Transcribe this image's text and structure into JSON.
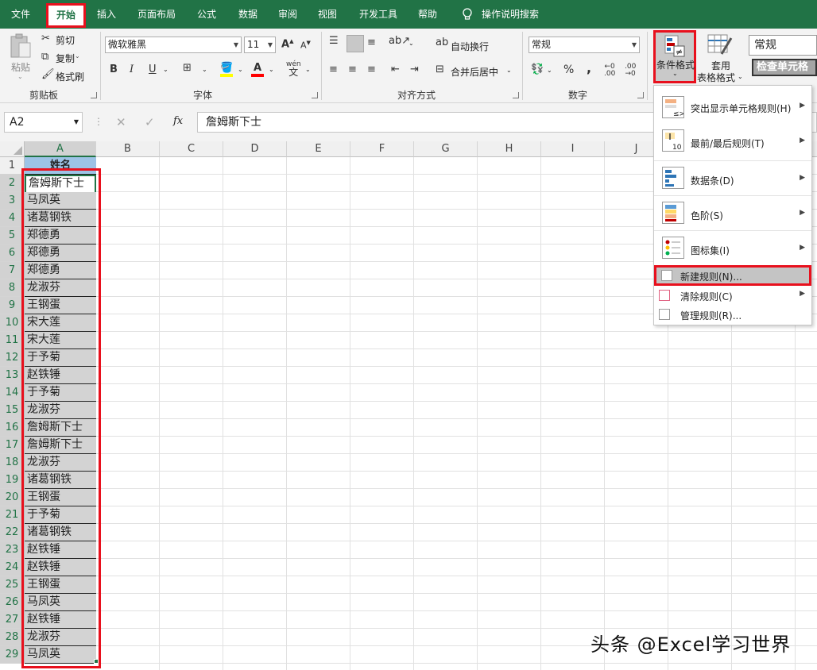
{
  "tabs": [
    "文件",
    "开始",
    "插入",
    "页面布局",
    "公式",
    "数据",
    "审阅",
    "视图",
    "开发工具",
    "帮助",
    "操作说明搜索"
  ],
  "clipboard": {
    "paste": "粘贴",
    "cut": "剪切",
    "copy": "复制",
    "format_painter": "格式刷",
    "label": "剪贴板"
  },
  "font": {
    "name": "微软雅黑",
    "size": "11",
    "bold": "B",
    "italic": "I",
    "underline": "U",
    "label": "字体",
    "bigger": "A",
    "smaller": "A",
    "pinyin": "wén"
  },
  "alignment": {
    "wrap": "自动换行",
    "merge": "合并后居中",
    "label": "对齐方式"
  },
  "number": {
    "format": "常规",
    "percent": "%",
    "comma": ",",
    "label": "数字"
  },
  "styles": {
    "conditional": "条件格式",
    "table_line1": "套用",
    "table_line2": "表格格式",
    "style_normal": "常规",
    "style_check": "检查单元格"
  },
  "name_box": "A2",
  "formula_bar": {
    "fx": "fx",
    "value": "詹姆斯下士"
  },
  "columns": [
    "A",
    "B",
    "C",
    "D",
    "E",
    "F",
    "G",
    "H",
    "I",
    "J"
  ],
  "rows": [
    "1",
    "2",
    "3",
    "4",
    "5",
    "6",
    "7",
    "8",
    "9",
    "10",
    "11",
    "12",
    "13",
    "14",
    "15",
    "16",
    "17",
    "18",
    "19",
    "20",
    "21",
    "22",
    "23",
    "24",
    "25",
    "26",
    "27",
    "28",
    "29"
  ],
  "header_cell": "姓名",
  "cells": [
    "詹姆斯下士",
    "马凤英",
    "诸葛钢铁",
    "郑德勇",
    "郑德勇",
    "郑德勇",
    "龙淑芬",
    "王钢蛋",
    "宋大莲",
    "宋大莲",
    "于予菊",
    "赵铁锤",
    "于予菊",
    "龙淑芬",
    "詹姆斯下士",
    "詹姆斯下士",
    "龙淑芬",
    "诸葛钢铁",
    "王钢蛋",
    "于予菊",
    "诸葛钢铁",
    "赵铁锤",
    "赵铁锤",
    "王钢蛋",
    "马凤英",
    "赵铁锤",
    "龙淑芬",
    "马凤英"
  ],
  "menu": {
    "highlight": "突出显示单元格规则(H)",
    "topbottom": "最前/最后规则(T)",
    "databar": "数据条(D)",
    "colorscale": "色阶(S)",
    "iconset": "图标集(I)",
    "new_rule": "新建规则(N)...",
    "clear_rule": "清除规则(C)",
    "manage_rule": "管理规则(R)..."
  },
  "watermark": "头条 @Excel学习世界",
  "colors": {
    "excel_green": "#217346",
    "highlight_red": "#e8101d",
    "selection_gray": "#d3d3d3",
    "header_blue": "#9dc3e6"
  }
}
